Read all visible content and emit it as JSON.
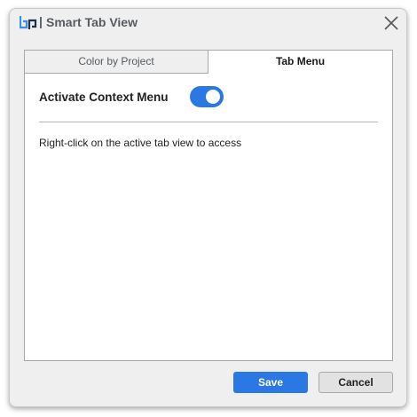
{
  "window": {
    "separator": "|",
    "title": "Smart Tab View",
    "logo_icon": "bp-logo-icon",
    "close_icon": "close-icon"
  },
  "tabs": [
    {
      "label": "Color by Project",
      "active": false
    },
    {
      "label": "Tab Menu",
      "active": true
    }
  ],
  "settings": {
    "context_menu_label": "Activate Context Menu",
    "context_menu_enabled": true,
    "description": "Right-click on the active tab view to access"
  },
  "buttons": {
    "save_label": "Save",
    "cancel_label": "Cancel"
  },
  "colors": {
    "accent": "#2b78e4",
    "logo_blue": "#3a8ee6",
    "logo_dark": "#1f2f4a"
  }
}
